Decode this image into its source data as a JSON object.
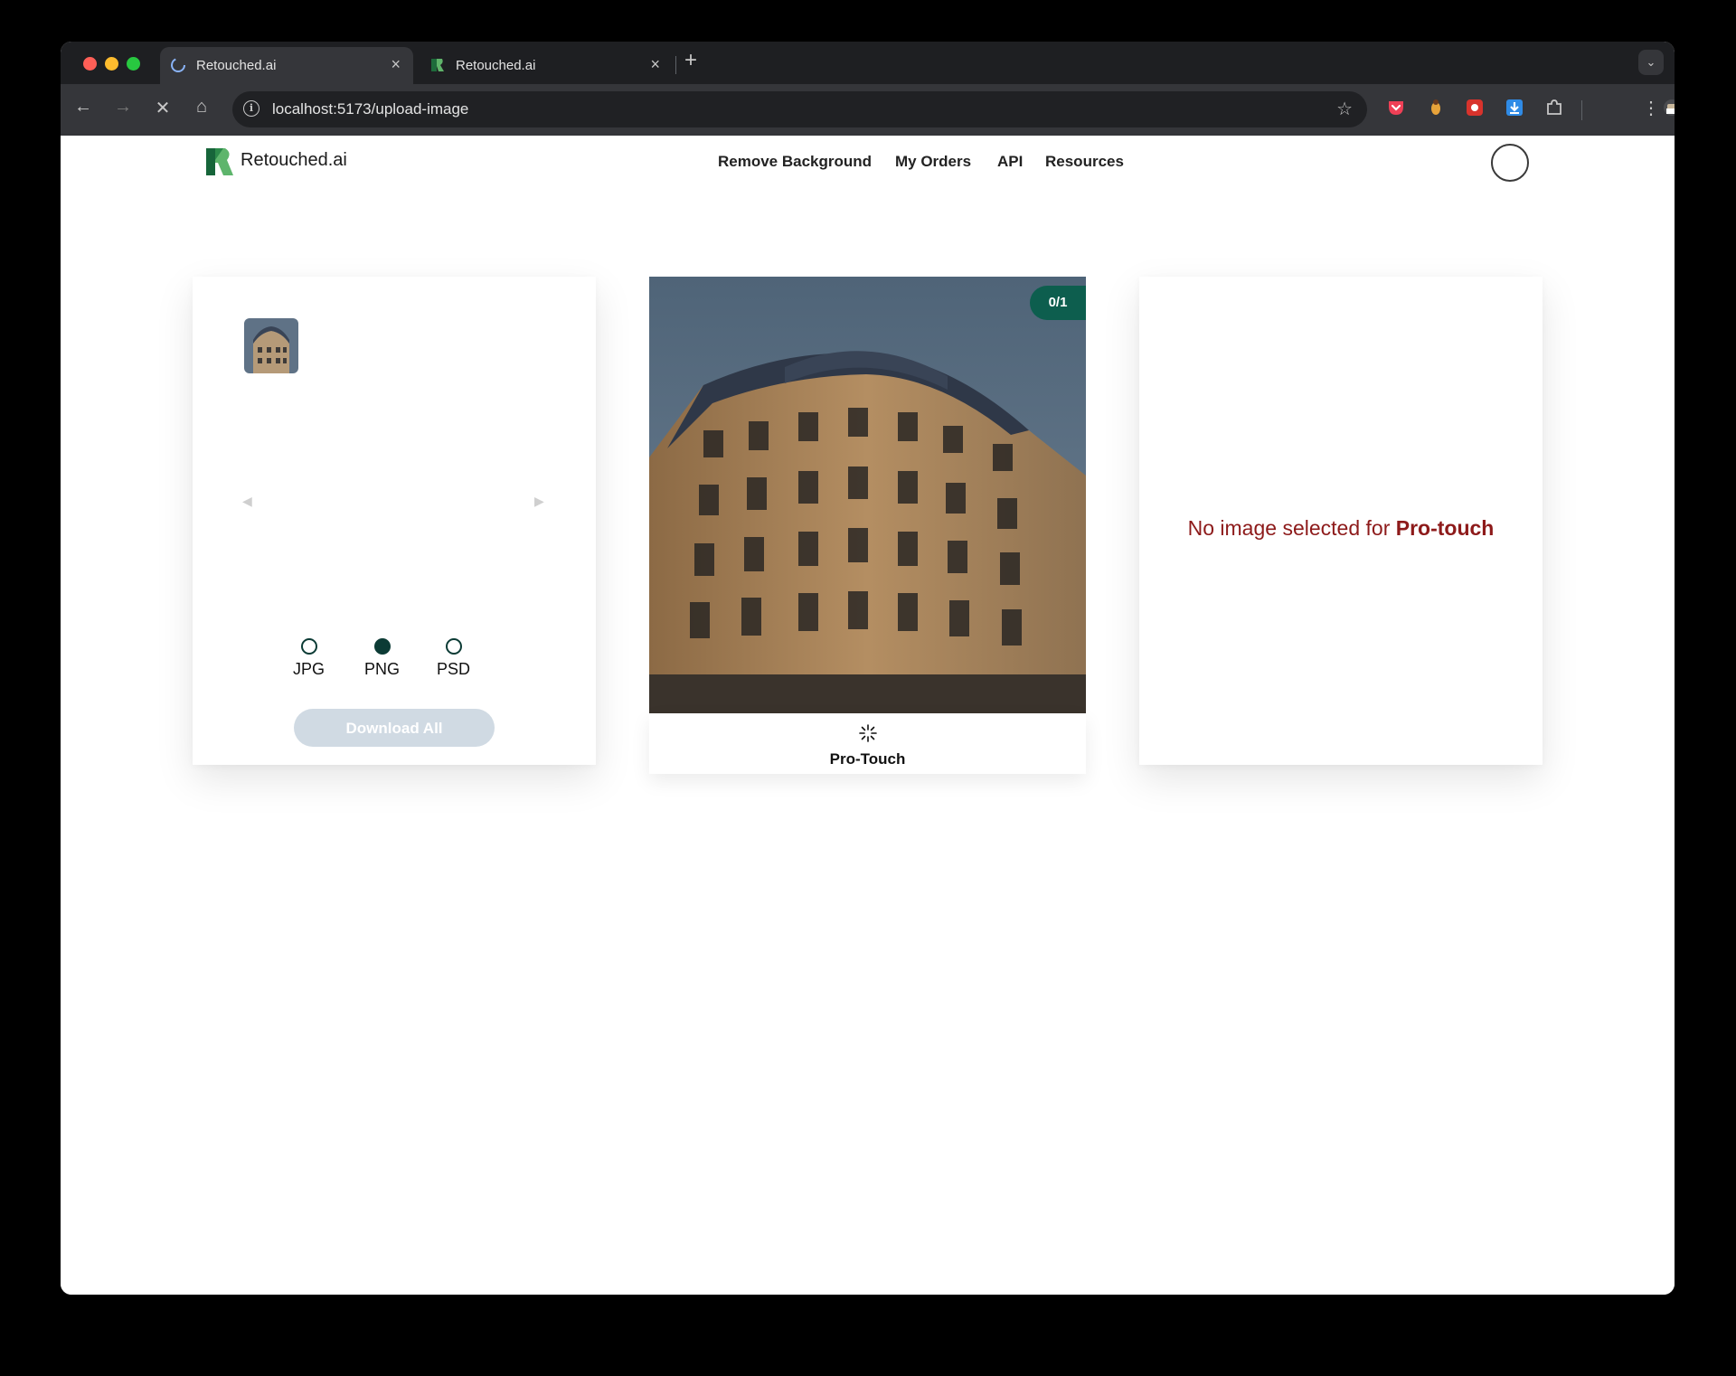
{
  "browser": {
    "tabs": [
      {
        "title": "Retouched.ai",
        "active": true,
        "close": "×"
      },
      {
        "title": "Retouched.ai",
        "active": false,
        "close": "×"
      }
    ],
    "new_tab": "+",
    "tab_dropdown": "⌄",
    "url": "localhost:5173/upload-image",
    "nav": {
      "back": "←",
      "forward": "→",
      "stop": "✕",
      "home": "⌂"
    },
    "star": "☆",
    "menu": "⋮",
    "info": "i"
  },
  "site": {
    "logo_text": "Retouched.ai",
    "nav": [
      "Remove Background",
      "My Orders",
      "API",
      "Resources"
    ],
    "brand_color": "#0d5e4e"
  },
  "left_panel": {
    "prev": "◀",
    "next": "▶",
    "formats": [
      {
        "label": "JPG",
        "checked": false
      },
      {
        "label": "PNG",
        "checked": true
      },
      {
        "label": "PSD",
        "checked": false
      }
    ],
    "download_label": "Download All"
  },
  "preview": {
    "count": "0/1",
    "label": "Pro-Touch"
  },
  "right_panel": {
    "message_prefix": "No image selected for ",
    "message_emphasis": "Pro-touch",
    "message_color": "#8d1a1a"
  }
}
